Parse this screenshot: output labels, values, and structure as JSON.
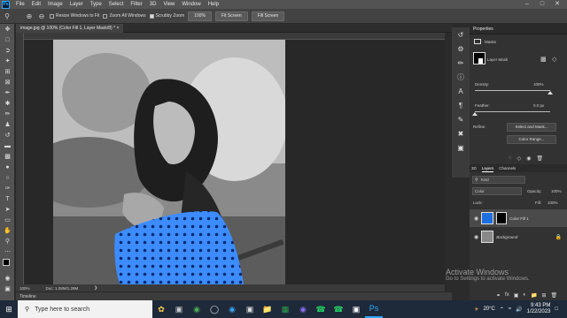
{
  "menu": {
    "app_icon": "Ps",
    "items": [
      "File",
      "Edit",
      "Image",
      "Layer",
      "Type",
      "Select",
      "Filter",
      "3D",
      "View",
      "Window",
      "Help"
    ],
    "window_controls": [
      "minimize-icon",
      "maximize-icon",
      "close-icon"
    ]
  },
  "options_bar": {
    "resize_windows": "Resize Windows to Fit",
    "zoom_all": "Zoom All Windows",
    "scrubby_zoom": "Scrubby Zoom",
    "zoom_value": "100%",
    "fit_screen": "Fit Screen",
    "fill_screen": "Fill Screen"
  },
  "document": {
    "tab_title": "image.jpg @ 100% (Color Fill 1, Layer Mask/8) *",
    "zoom": "100%",
    "doc_size": "Doc: 1.08M/1.29M"
  },
  "timeline": {
    "label": "Timeline"
  },
  "properties": {
    "title": "Properties",
    "masks_label": "Masks",
    "layer_mask_label": "Layer Mask",
    "density_label": "Density:",
    "density_value": "100%",
    "density_level": 1.0,
    "feather_label": "Feather:",
    "feather_value": "0.0 px",
    "feather_level": 0.0,
    "refine_label": "Refine:",
    "select_mask_btn": "Select and Mask...",
    "color_range_btn": "Color Range..."
  },
  "layers_panel": {
    "tabs": [
      "3D",
      "Layers",
      "Channels"
    ],
    "kind_label": "Kind",
    "blend_mode": "Color",
    "opacity_label": "Opacity:",
    "opacity_value": "100%",
    "lock_label": "Lock:",
    "fill_label": "Fill:",
    "fill_value": "100%",
    "layers": [
      {
        "name": "Color Fill 1",
        "italic": false,
        "color": "#1e6fe0"
      },
      {
        "name": "Background",
        "italic": true,
        "color": ""
      }
    ]
  },
  "watermark": {
    "line1": "Activate Windows",
    "line2": "Go to Settings to activate Windows."
  },
  "taskbar": {
    "search_placeholder": "Type here to search",
    "weather": "20°C",
    "time": "9:43 PM",
    "date": "1/22/2023"
  },
  "colors": {
    "accent": "#1e6fe0",
    "dress_blue": "#3d8cff",
    "menubar": "#535353",
    "taskbar": "#1e2a3a"
  }
}
